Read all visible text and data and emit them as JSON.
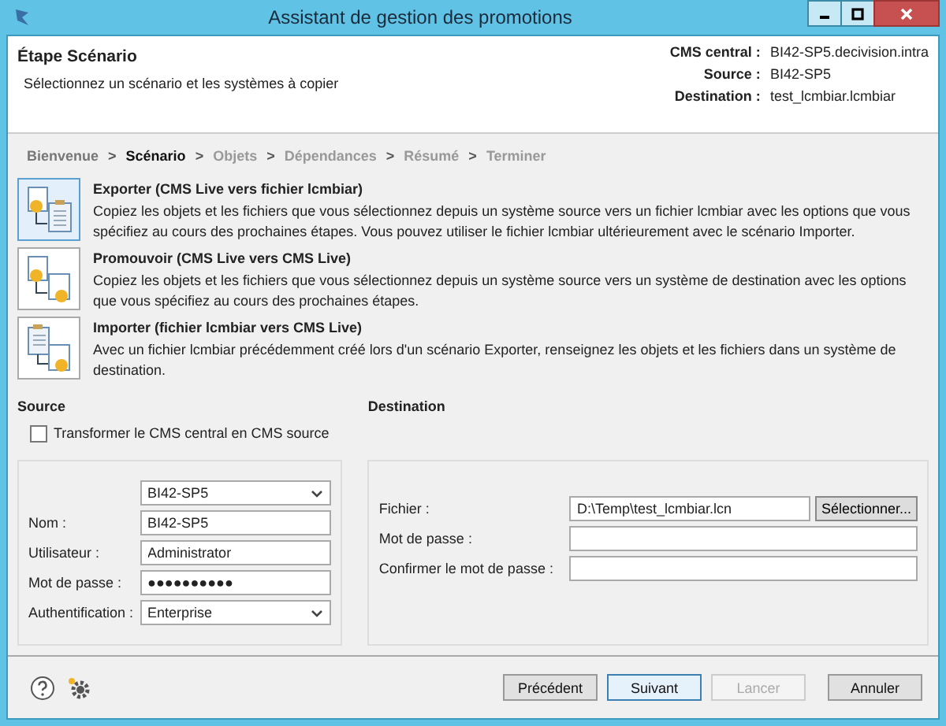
{
  "window": {
    "title": "Assistant de gestion des promotions"
  },
  "header": {
    "title": "Étape Scénario",
    "subtitle": "Sélectionnez un scénario et les systèmes à copier",
    "info": [
      {
        "label": "CMS central :",
        "value": "BI42-SP5.decivision.intra"
      },
      {
        "label": "Source :",
        "value": "BI42-SP5"
      },
      {
        "label": "Destination :",
        "value": "test_lcmbiar.lcmbiar"
      }
    ]
  },
  "steps": [
    {
      "label": "Bienvenue",
      "selected": false,
      "disabled": false
    },
    {
      "label": "Scénario",
      "selected": true,
      "disabled": false
    },
    {
      "label": "Objets",
      "selected": false,
      "disabled": true
    },
    {
      "label": "Dépendances",
      "selected": false,
      "disabled": true
    },
    {
      "label": "Résumé",
      "selected": false,
      "disabled": true
    },
    {
      "label": "Terminer",
      "selected": false,
      "disabled": true
    }
  ],
  "step_separator": ">",
  "scenarios": [
    {
      "title": "Exporter (CMS Live vers fichier lcmbiar)",
      "description": "Copiez les objets et les fichiers que vous sélectionnez depuis un système source vers un fichier lcmbiar avec les options que vous spécifiez au cours des prochaines étapes. Vous pouvez utiliser le fichier lcmbiar ultérieurement avec le scénario Importer.",
      "selected": true
    },
    {
      "title": "Promouvoir (CMS Live vers CMS Live)",
      "description": "Copiez les objets et les fichiers que vous sélectionnez depuis un système source vers un système de destination avec les options que vous spécifiez au cours des prochaines étapes.",
      "selected": false
    },
    {
      "title": "Importer (fichier lcmbiar vers CMS Live)",
      "description": "Avec un fichier lcmbiar précédemment créé lors d'un scénario  Exporter, renseignez les objets et les fichiers dans un système de destination.",
      "selected": false
    }
  ],
  "source": {
    "heading": "Source",
    "checkbox": {
      "label": "Transformer le CMS central en CMS source",
      "checked": false
    },
    "fields": [
      {
        "kind": "dropdown",
        "value": "BI42-SP5"
      },
      {
        "kind": "text",
        "label": "Nom :",
        "value": "BI42-SP5"
      },
      {
        "kind": "text",
        "label": "Utilisateur :",
        "value": "Administrator"
      },
      {
        "kind": "text",
        "label": "Mot de passe :",
        "value": "●●●●●●●●●●"
      },
      {
        "kind": "dropdown",
        "label": "Authentification :",
        "value": "Enterprise"
      }
    ]
  },
  "destination": {
    "heading": "Destination",
    "fields": [
      {
        "kind": "file",
        "label": "Fichier :",
        "value": "D:\\Temp\\test_lcmbiar.lcn",
        "button": "Sélectionner..."
      },
      {
        "kind": "text",
        "label": "Mot de passe :"
      },
      {
        "kind": "text",
        "label": "Confirmer le mot de passe :"
      }
    ]
  },
  "buttons": [
    {
      "label": "Précédent",
      "disabled": false,
      "focused": false
    },
    {
      "label": "Suivant",
      "disabled": false,
      "focused": true
    },
    {
      "label": "Lancer",
      "disabled": true,
      "focused": false
    },
    {
      "label": "Annuler",
      "disabled": false,
      "focused": false
    }
  ]
}
